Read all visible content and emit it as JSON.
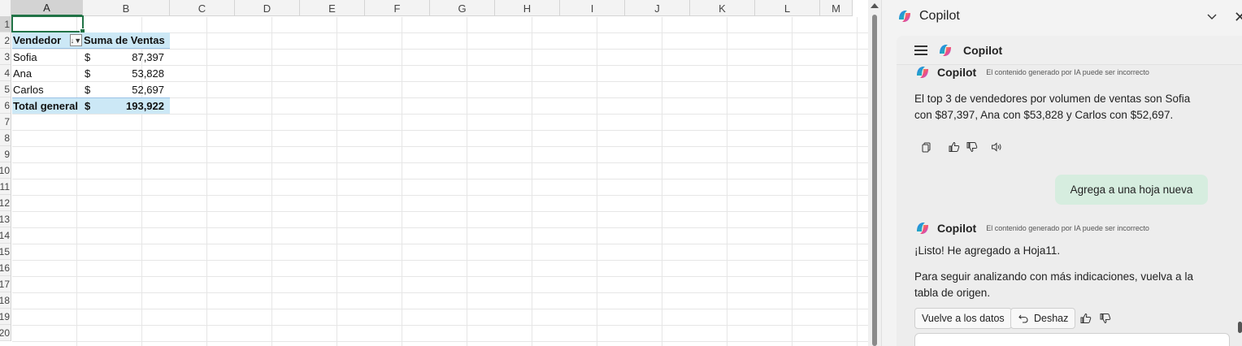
{
  "sheet": {
    "columns": [
      "A",
      "B",
      "C",
      "D",
      "E",
      "F",
      "G",
      "H",
      "I",
      "J",
      "K",
      "L",
      "M"
    ],
    "rows": [
      "1",
      "2",
      "3",
      "4",
      "5",
      "6",
      "7",
      "8",
      "9",
      "10",
      "11",
      "12",
      "13",
      "14",
      "15",
      "16",
      "17",
      "18",
      "19",
      "20"
    ],
    "pivot": {
      "header_a": "Vendedor",
      "header_b": "Suma de Ventas",
      "rows": [
        {
          "name": "Sofia",
          "currency": "$",
          "value": "87,397"
        },
        {
          "name": "Ana",
          "currency": "$",
          "value": "53,828"
        },
        {
          "name": "Carlos",
          "currency": "$",
          "value": "52,697"
        }
      ],
      "total": {
        "name": "Total general",
        "currency": "$",
        "value": "193,922"
      }
    }
  },
  "copilot": {
    "pane_title": "Copilot",
    "chat_title": "Copilot",
    "messages": [
      {
        "author": "Copilot",
        "note": "El contenido generado por IA puede ser incorrecto",
        "text": "El top 3 de vendedores por volumen de ventas son Sofia con $87,397, Ana con $53,828 y Carlos con $52,697."
      },
      {
        "author": "Copilot",
        "note": "El contenido generado por IA puede ser incorrecto",
        "text1": "¡Listo! He agregado  a Hoja11.",
        "text2": "Para seguir analizando con más indicaciones, vuelva a la tabla de origen."
      }
    ],
    "user_message": "Agrega a una hoja nueva",
    "buttons": {
      "back_to_data": "Vuelve a los datos",
      "undo": "Deshaz"
    }
  },
  "colors": {
    "accent_green": "#217346",
    "pivot_blue": "#cce8f6",
    "user_bubble": "#d6eddf"
  },
  "icons": [
    "copy-icon",
    "thumbs-up-icon",
    "thumbs-down-icon",
    "speaker-icon",
    "undo-icon",
    "chevron-down-icon",
    "close-icon",
    "hamburger-icon",
    "copilot-logo"
  ]
}
